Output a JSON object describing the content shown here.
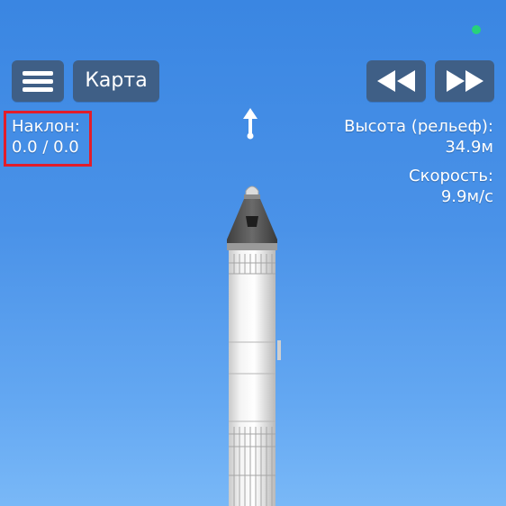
{
  "hud": {
    "status_indicator_color": "#27d27a",
    "menu_icon": "hamburger-menu-icon",
    "map_button_label": "Карта",
    "rewind_icon": "rewind-icon",
    "fast_forward_icon": "fast-forward-icon",
    "tilt_label": "Наклон:",
    "tilt_value": "0.0 / 0.0",
    "altitude_label": "Высота (рельеф):",
    "altitude_value": "34.9м",
    "speed_label": "Скорость:",
    "speed_value": "9.9м/с",
    "direction_icon": "heading-arrow-icon",
    "highlight_color": "#e21d2a"
  },
  "scene": {
    "object": "rocket",
    "sky_color": "#4a92e8"
  }
}
